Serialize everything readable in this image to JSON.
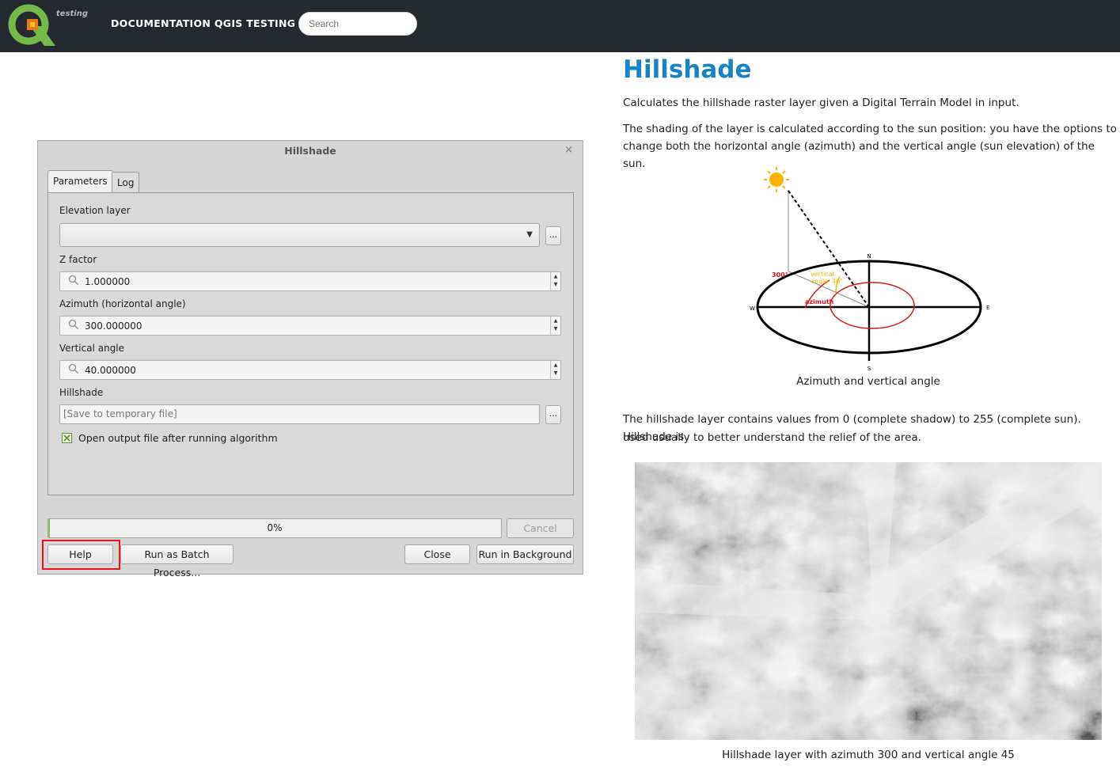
{
  "header": {
    "logo_subtitle": "testing",
    "site_title": "DOCUMENTATION QGIS TESTING",
    "search_placeholder": "Search",
    "colors": {
      "bar": "#252a31",
      "logo_green": "#74b94a",
      "logo_orange": "#ee7913"
    }
  },
  "dialog": {
    "title": "Hillshade",
    "close_glyph": "×",
    "tabs": [
      {
        "label": "Parameters",
        "active": true
      },
      {
        "label": "Log",
        "active": false
      }
    ],
    "fields": {
      "elevation_label": "Elevation layer",
      "elevation_value": "",
      "browse_label": "...",
      "zfactor_label": "Z factor",
      "zfactor_value": "1.000000",
      "azimuth_label": "Azimuth (horizontal angle)",
      "azimuth_value": "300.000000",
      "vertical_label": "Vertical angle",
      "vertical_value": "40.000000",
      "output_label": "Hillshade",
      "output_placeholder": "[Save to temporary file]",
      "open_output_label": "Open output file after running algorithm",
      "open_output_checked": true
    },
    "progress": {
      "value": 0,
      "text": "0%"
    },
    "buttons": {
      "cancel": "Cancel",
      "help": "Help",
      "batch": "Run as Batch Process...",
      "close": "Close",
      "background": "Run in Background"
    }
  },
  "doc": {
    "title": "Hillshade",
    "intro": "Calculates the hillshade raster layer given a Digital Terrain Model in input.",
    "shading_line1": "The shading of the layer is calculated according to the sun position: you have the options to",
    "shading_line2": "change both the horizontal angle (azimuth) and the vertical angle (sun elevation) of the sun.",
    "diagram": {
      "north": "N",
      "south": "S",
      "east": "E",
      "west": "W",
      "azimuth_value": "300°",
      "vertical_label_1": "vertical",
      "vertical_label_2": "angle",
      "vertical_value": "40°",
      "azimuth_label": "azimuth",
      "caption": "Azimuth and vertical angle"
    },
    "values_line1": "The hillshade layer contains values from 0 (complete shadow) to 255 (complete sun). Hillshade is",
    "values_line2": "used usually to better understand the relief of the area.",
    "image_caption": "Hillshade layer with azimuth 300 and vertical angle 45"
  }
}
